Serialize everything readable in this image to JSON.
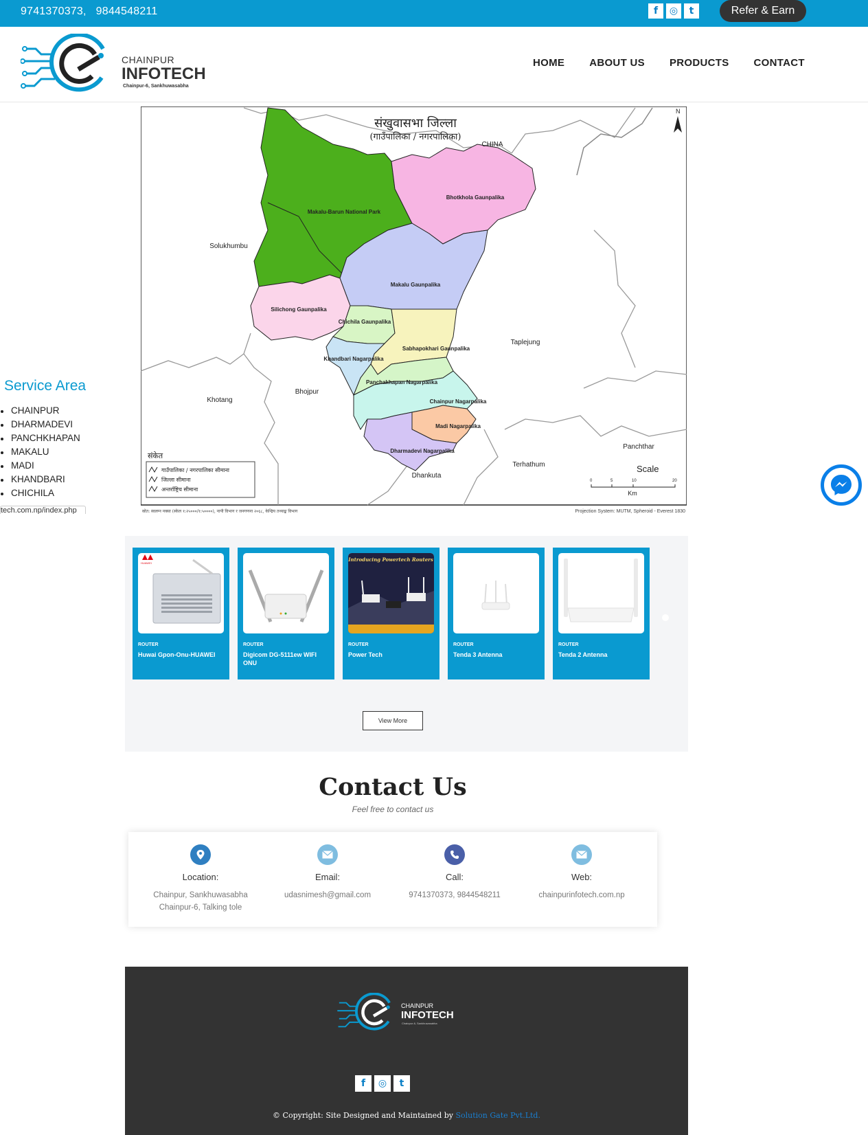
{
  "topbar": {
    "phone1": "9741370373,",
    "phone2": "9844548211",
    "refer_label": "Refer & Earn",
    "social": [
      "f",
      "◎",
      "t"
    ]
  },
  "header": {
    "logo_line1": "CHAINPUR",
    "logo_line2": "INFOTECH",
    "logo_line3": "Chainpur-6, Sankhuwasabha",
    "nav": [
      "HOME",
      "ABOUT US",
      "PRODUCTS",
      "CONTACT"
    ]
  },
  "map": {
    "title": "संखुवासभा जिल्ला",
    "subtitle": "(गाउँपालिका / नगरपालिका)",
    "north": "N",
    "regions": [
      "Makalu-Barun National Park",
      "Bhotkhola Gaunpalika",
      "Makalu Gaunpalika",
      "Silichong Gaunpalika",
      "Chichila Gaunpalika",
      "Sabhapokhari Gaunpalika",
      "Khandbari Nagarpalika",
      "Panchakhapan Nagarpalika",
      "Chainpur Nagarpalika",
      "Madi Nagarpalika",
      "Dharmadevi Nagarpalika"
    ],
    "neighbors": [
      "CHINA",
      "Solukhumbu",
      "Taplejung",
      "Khotang",
      "Bhojpur",
      "Panchthar",
      "Terhathum",
      "Dhankuta"
    ],
    "legend_title": "संकेत",
    "legend_items": [
      "गाउँपालिका / नगरपालिका सीमाना",
      "जिल्ला सीमाना",
      "अन्तर्राष्ट्रिय सीमाना"
    ],
    "scale_label": "Scale",
    "scale_ticks": [
      "0",
      "5",
      "10",
      "20"
    ],
    "scale_unit": "Km",
    "source": "स्रोत: स्वलग्न नक्सा (स्केल १:२५०००/१:५००००), नापी विभाग र जनगणना २०६८, केन्द्रिय तथ्याङ्क विभाग",
    "projection": "Projection System: MUTM, Spheroid - Everest 1830"
  },
  "service": {
    "title": "Service Area",
    "items": [
      "CHAINPUR",
      "DHARMADEVI",
      "PANCHKHAPAN",
      "MAKALU",
      "MADI",
      "KHANDBARI",
      "CHICHILA"
    ],
    "link": "tech.com.np/index.php"
  },
  "products": {
    "items": [
      {
        "category": "ROUTER",
        "name": "Huwai Gpon-Onu-HUAWEI",
        "badge": "HUAWEI"
      },
      {
        "category": "ROUTER",
        "name": "Digicom DG-5111ew WIFI ONU"
      },
      {
        "category": "ROUTER",
        "name": "Power Tech",
        "banner": "Introducing Powertech Routers"
      },
      {
        "category": "ROUTER",
        "name": "Tenda 3 Antenna"
      },
      {
        "category": "ROUTER",
        "name": "Tenda 2 Antenna"
      }
    ],
    "view_more": "View More"
  },
  "contact": {
    "title": "Contact Us",
    "subtitle": "Feel free to contact us",
    "items": [
      {
        "label": "Location:",
        "value": "Chainpur, Sankhuwasabha Chainpur-6, Talking tole",
        "color": "#2f7fc1",
        "icon": "location-icon"
      },
      {
        "label": "Email:",
        "value": "udasnimesh@gmail.com",
        "color": "#7fbde0",
        "icon": "email-icon"
      },
      {
        "label": "Call:",
        "value": "9741370373, 9844548211",
        "color": "#4a5fa8",
        "icon": "phone-icon"
      },
      {
        "label": "Web:",
        "value": "chainpurinfotech.com.np",
        "color": "#7fbde0",
        "icon": "web-icon"
      }
    ]
  },
  "footer": {
    "logo_line1": "CHAINPUR",
    "logo_line2": "INFOTECH",
    "logo_line3": "Chainpur-6, Sankhuwasabha",
    "copyright_prefix": "© Copyright:   Site Designed and Maintained by ",
    "copyright_company": "Solution Gate Pvt.Ltd."
  },
  "colors": {
    "brand_blue": "#0a9ad0",
    "dark": "#333333",
    "national_park": "#4caf1c",
    "bhotkhola": "#f7b5e3",
    "makalu": "#c5ccf5"
  }
}
